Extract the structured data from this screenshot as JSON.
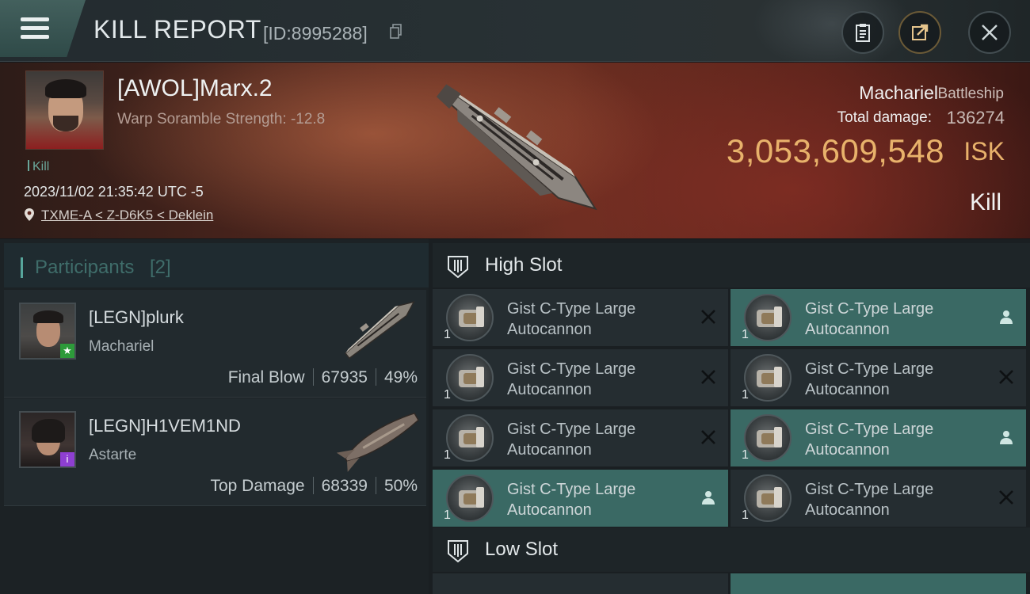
{
  "header": {
    "title": "KILL REPORT",
    "report_id": "[ID:8995288]"
  },
  "victim": {
    "name": "[AWOL]Marx.2",
    "scramble": "Warp Soramble Strength: -12.8",
    "kill_tag": "Kill",
    "timestamp": "2023/11/02 21:35:42 UTC -5",
    "location": "TXME-A < Z-D6K5 < Deklein",
    "ship_name": "Machariel",
    "ship_class": "Battleship",
    "total_damage_label": "Total damage:",
    "total_damage": "136274",
    "isk_value": "3,053,609,548",
    "isk_unit": "ISK",
    "result": "Kill"
  },
  "participants": {
    "title": "Participants",
    "count": "[2]",
    "items": [
      {
        "name": "[LEGN]plurk",
        "ship": "Machariel",
        "role": "Final Blow",
        "damage": "67935",
        "percent": "49%",
        "badge": "★"
      },
      {
        "name": "[LEGN]H1VEM1ND",
        "ship": "Astarte",
        "role": "Top Damage",
        "damage": "68339",
        "percent": "50%",
        "badge": "i"
      }
    ]
  },
  "fitting": {
    "high_slot_title": "High Slot",
    "low_slot_title": "Low Slot",
    "high_items": [
      {
        "qty": "1",
        "name": "Gist C-Type Large Autocannon",
        "status": "destroyed"
      },
      {
        "qty": "1",
        "name": "Gist C-Type Large Autocannon",
        "status": "dropped"
      },
      {
        "qty": "1",
        "name": "Gist C-Type Large Autocannon",
        "status": "destroyed"
      },
      {
        "qty": "1",
        "name": "Gist C-Type Large Autocannon",
        "status": "destroyed"
      },
      {
        "qty": "1",
        "name": "Gist C-Type Large Autocannon",
        "status": "destroyed"
      },
      {
        "qty": "1",
        "name": "Gist C-Type Large Autocannon",
        "status": "dropped"
      },
      {
        "qty": "1",
        "name": "Gist C-Type Large Autocannon",
        "status": "dropped"
      },
      {
        "qty": "1",
        "name": "Gist C-Type Large Autocannon",
        "status": "destroyed"
      }
    ]
  },
  "colors": {
    "accent_teal": "#57a59b",
    "dropped_row": "#3a6964",
    "isk_gold": "#e8b26b"
  },
  "icons": [
    "menu-icon",
    "copy-icon",
    "clipboard-icon",
    "share-icon",
    "close-icon",
    "location-pin-icon",
    "slot-icon",
    "destroyed-icon",
    "dropped-icon"
  ]
}
